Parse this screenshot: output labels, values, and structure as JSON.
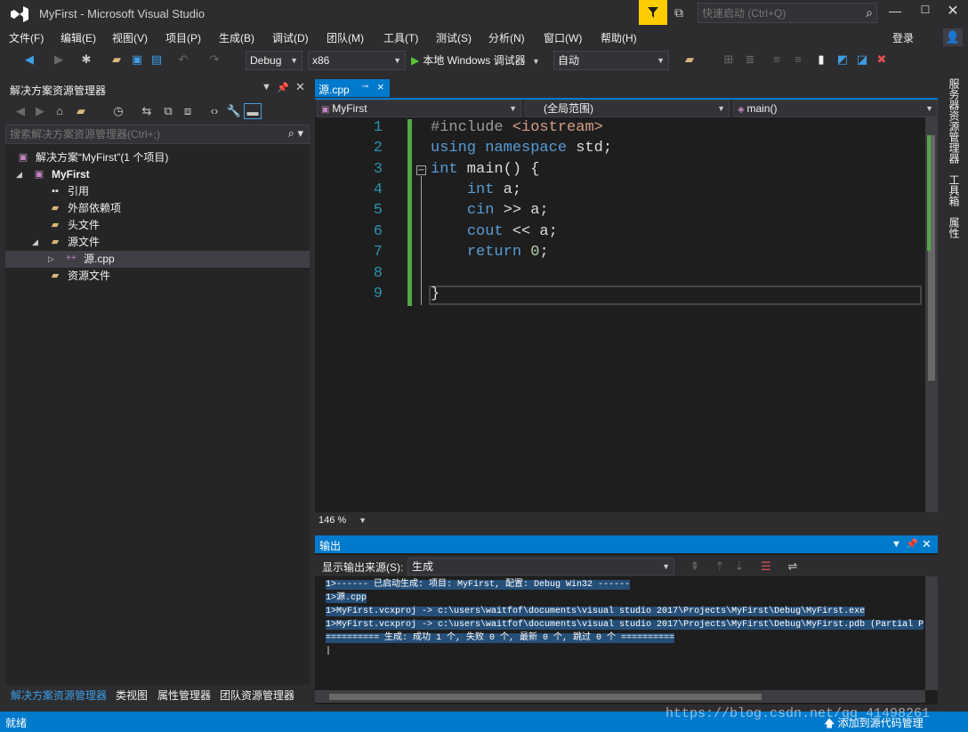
{
  "window": {
    "title": "MyFirst - Microsoft Visual Studio",
    "quick_launch_placeholder": "快速启动 (Ctrl+Q)"
  },
  "menu": {
    "items": [
      "文件(F)",
      "编辑(E)",
      "视图(V)",
      "项目(P)",
      "生成(B)",
      "调试(D)",
      "团队(M)",
      "工具(T)",
      "测试(S)",
      "分析(N)",
      "窗口(W)",
      "帮助(H)"
    ],
    "login": "登录"
  },
  "toolbar": {
    "config": "Debug",
    "platform": "x86",
    "start_debug": "本地 Windows 调试器",
    "auto": "自动"
  },
  "solution_explorer": {
    "title": "解决方案资源管理器",
    "search_placeholder": "搜索解决方案资源管理器(Ctrl+;)",
    "tree": [
      {
        "label": "解决方案“MyFirst”(1 个项目)",
        "icon": "solution-icon"
      },
      {
        "label": "MyFirst",
        "icon": "project-icon"
      },
      {
        "label": "引用",
        "icon": "references-icon"
      },
      {
        "label": "外部依赖项",
        "icon": "folder-icon"
      },
      {
        "label": "头文件",
        "icon": "folder-icon"
      },
      {
        "label": "源文件",
        "icon": "folder-icon"
      },
      {
        "label": "源.cpp",
        "icon": "cpp-file-icon"
      },
      {
        "label": "资源文件",
        "icon": "folder-icon"
      }
    ]
  },
  "left_tabs": [
    "解决方案资源管理器",
    "类视图",
    "属性管理器",
    "团队资源管理器"
  ],
  "editor": {
    "tab": "源.cpp",
    "nav_project": "MyFirst",
    "nav_scope": "(全局范围)",
    "nav_member": "main()",
    "line_numbers": [
      "1",
      "2",
      "3",
      "4",
      "5",
      "6",
      "7",
      "8",
      "9"
    ],
    "zoom": "146 %"
  },
  "output": {
    "title": "输出",
    "source_label": "显示输出来源(S):",
    "source_value": "生成",
    "lines": [
      "1>------ 已启动生成: 项目: MyFirst, 配置: Debug Win32 ------",
      "1>源.cpp",
      "1>MyFirst.vcxproj -> c:\\users\\waitfof\\documents\\visual studio 2017\\Projects\\MyFirst\\Debug\\MyFirst.exe",
      "1>MyFirst.vcxproj -> c:\\users\\waitfof\\documents\\visual studio 2017\\Projects\\MyFirst\\Debug\\MyFirst.pdb (Partial P",
      "========== 生成: 成功 1 个, 失败 0 个, 最新 0 个, 跳过 0 个 =========="
    ]
  },
  "right_tabs": [
    "服务器资源管理器",
    "工具箱",
    "属性"
  ],
  "status": {
    "text": "就绪",
    "source_control": "添加到源代码管理",
    "watermark": "https://blog.csdn.net/qq_41498261"
  }
}
